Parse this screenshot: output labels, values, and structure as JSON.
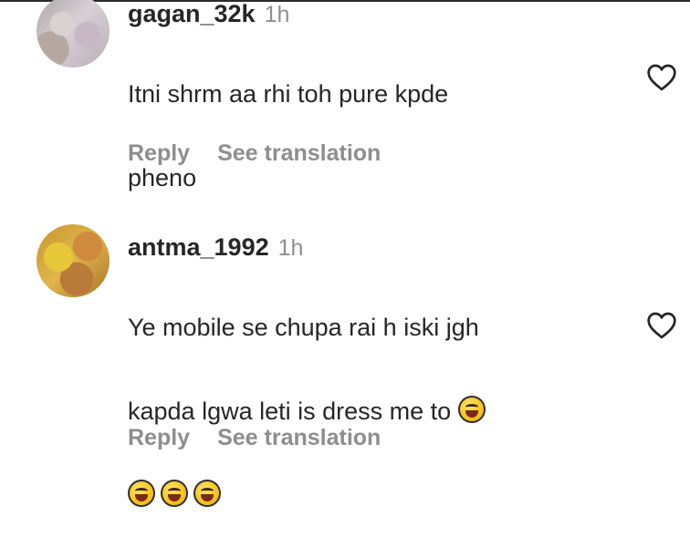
{
  "comments": [
    {
      "username": "gagan_32k",
      "time": "1h",
      "text_lines": [
        "Itni shrm aa rhi toh pure kpde",
        "pheno"
      ],
      "actions": {
        "reply": "Reply",
        "translate": "See translation"
      },
      "avatar_icon": "user-avatar"
    },
    {
      "username": "antma_1992",
      "time": "1h",
      "text_lines": [
        "Ye mobile se chupa rai h iski jgh",
        "kapda lgwa leti is dress me to"
      ],
      "emojis": [
        "😂",
        "😂",
        "😂",
        "😂"
      ],
      "actions": {
        "reply": "Reply",
        "translate": "See translation"
      },
      "avatar_icon": "user-avatar"
    }
  ],
  "icons": {
    "like": "heart-outline-icon"
  },
  "colors": {
    "text": "#262626",
    "secondary": "#8e8e8e",
    "background": "#ffffff"
  }
}
